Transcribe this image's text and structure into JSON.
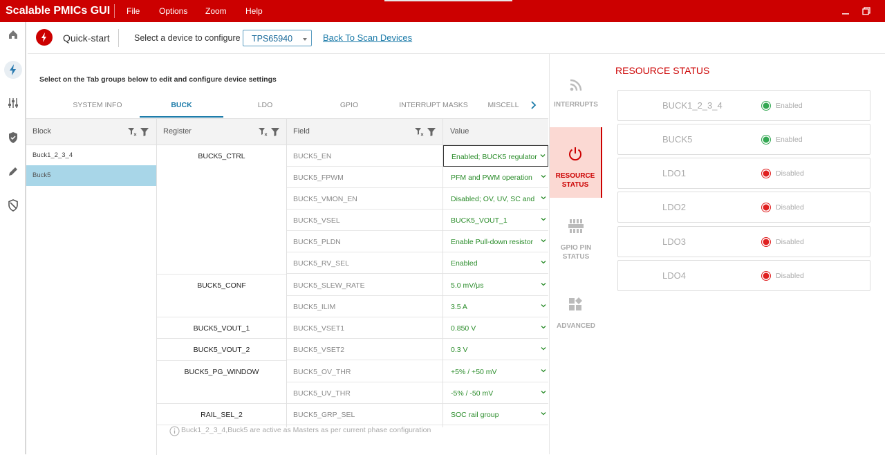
{
  "app": {
    "title": "Scalable PMICs GUI"
  },
  "menu": {
    "file": "File",
    "options": "Options",
    "zoom": "Zoom",
    "help": "Help"
  },
  "topbar": {
    "quickstart": "Quick-start",
    "select_label": "Select a device to configure",
    "device": "TPS65940",
    "back_link": "Back To Scan Devices"
  },
  "instruction": "Select on the Tab groups below to edit and configure device settings",
  "tabs": [
    "SYSTEM INFO",
    "BUCK",
    "LDO",
    "GPIO",
    "INTERRUPT MASKS",
    "MISCELL"
  ],
  "active_tab": "BUCK",
  "grid": {
    "headers": {
      "block": "Block",
      "register": "Register",
      "field": "Field",
      "value": "Value"
    },
    "blocks": [
      "Buck1_2_3_4",
      "Buck5"
    ],
    "selected_block": "Buck5",
    "registers": [
      "BUCK5_CTRL",
      "BUCK5_CONF",
      "BUCK5_VOUT_1",
      "BUCK5_VOUT_2",
      "BUCK5_PG_WINDOW",
      "RAIL_SEL_2"
    ],
    "rows": [
      {
        "field": "BUCK5_EN",
        "value": "Enabled; BUCK5 regulator"
      },
      {
        "field": "BUCK5_FPWM",
        "value": "PFM and PWM operation"
      },
      {
        "field": "BUCK5_VMON_EN",
        "value": "Disabled; OV, UV, SC and I"
      },
      {
        "field": "BUCK5_VSEL",
        "value": "BUCK5_VOUT_1"
      },
      {
        "field": "BUCK5_PLDN",
        "value": "Enable Pull-down resistor"
      },
      {
        "field": "BUCK5_RV_SEL",
        "value": "Enabled"
      },
      {
        "field": "BUCK5_SLEW_RATE",
        "value": "5.0 mV/μs"
      },
      {
        "field": "BUCK5_ILIM",
        "value": "3.5 A"
      },
      {
        "field": "BUCK5_VSET1",
        "value": "0.850 V"
      },
      {
        "field": "BUCK5_VSET2",
        "value": "0.3 V"
      },
      {
        "field": "BUCK5_OV_THR",
        "value": "+5% / +50 mV"
      },
      {
        "field": "BUCK5_UV_THR",
        "value": "-5% / -50 mV"
      },
      {
        "field": "BUCK5_GRP_SEL",
        "value": "SOC rail group"
      }
    ],
    "footnote": "Buck1_2_3_4,Buck5 are active as Masters as per current phase configuration"
  },
  "right_tabs": {
    "interrupts": "INTERRUPTS",
    "resource_status": "RESOURCE STATUS",
    "gpio_pin_status": "GPIO PIN STATUS",
    "advanced": "ADVANCED"
  },
  "resource_status": {
    "title": "RESOURCE STATUS",
    "items": [
      {
        "name": "BUCK1_2_3_4",
        "status": "Enabled",
        "color": "#34a853"
      },
      {
        "name": "BUCK5",
        "status": "Enabled",
        "color": "#34a853"
      },
      {
        "name": "LDO1",
        "status": "Disabled",
        "color": "#e02020"
      },
      {
        "name": "LDO2",
        "status": "Disabled",
        "color": "#e02020"
      },
      {
        "name": "LDO3",
        "status": "Disabled",
        "color": "#e02020"
      },
      {
        "name": "LDO4",
        "status": "Disabled",
        "color": "#e02020"
      }
    ]
  },
  "colors": {
    "brand": "#cc0000",
    "link": "#1a7aa8",
    "value_text": "#2a8c2a",
    "selected_row": "#a8d6e8"
  }
}
